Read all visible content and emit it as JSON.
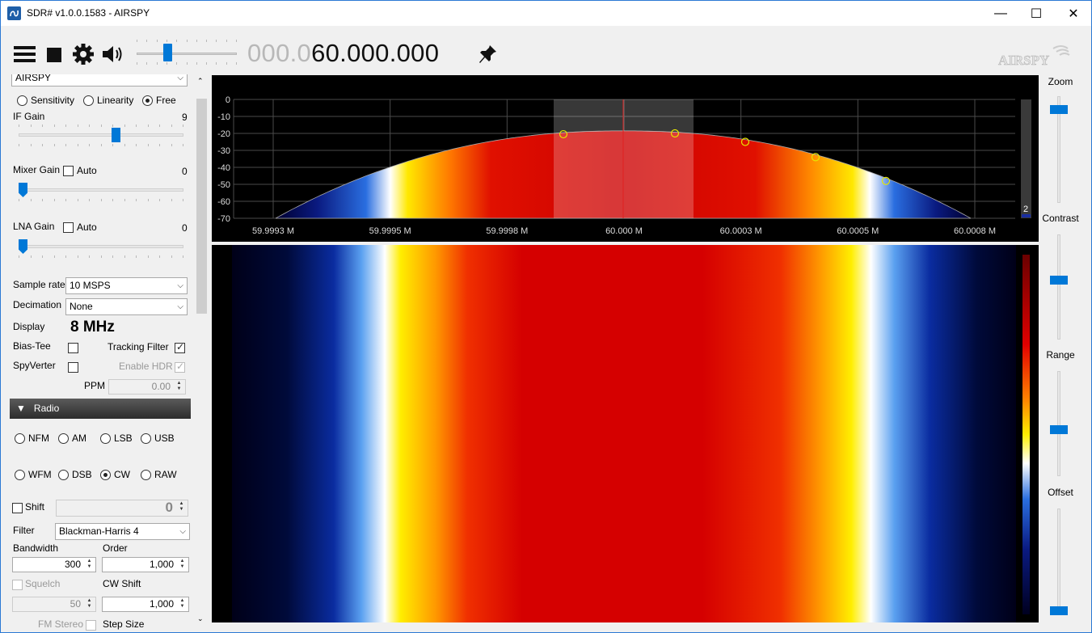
{
  "window": {
    "title": "SDR# v1.0.0.1583 - AIRSPY",
    "minimize": "—",
    "maximize": "☐",
    "close": "✕"
  },
  "toolbar": {
    "freq_dim": "000.0",
    "freq_bright": "60.000.000",
    "volume_percent": 30,
    "logo_text": "AIRSPY"
  },
  "source": {
    "device_combo": "AIRSPY",
    "gain_modes": [
      "Sensitivity",
      "Linearity",
      "Free"
    ],
    "gain_mode_selected": "Free",
    "if_gain_label": "IF Gain",
    "if_gain_value": "9",
    "mixer_gain_label": "Mixer Gain",
    "mixer_auto_label": "Auto",
    "mixer_gain_value": "0",
    "lna_gain_label": "LNA Gain",
    "lna_auto_label": "Auto",
    "lna_gain_value": "0",
    "sample_rate_label": "Sample rate",
    "sample_rate_value": "10 MSPS",
    "decimation_label": "Decimation",
    "decimation_value": "None",
    "display_label": "Display",
    "display_value": "8 MHz",
    "bias_tee_label": "Bias-Tee",
    "tracking_filter_label": "Tracking Filter",
    "spyverter_label": "SpyVerter",
    "enable_hdr_label": "Enable HDR",
    "ppm_label": "PPM",
    "ppm_value": "0.00"
  },
  "radio": {
    "header": "Radio",
    "header_arrow": "▼",
    "modes_row1": [
      "NFM",
      "AM",
      "LSB",
      "USB"
    ],
    "modes_row2": [
      "WFM",
      "DSB",
      "CW",
      "RAW"
    ],
    "mode_selected": "CW",
    "shift_label": "Shift",
    "shift_value": "0",
    "filter_label": "Filter",
    "filter_value": "Blackman-Harris 4",
    "bandwidth_label": "Bandwidth",
    "bandwidth_value": "300",
    "order_label": "Order",
    "order_value": "1,000",
    "squelch_label": "Squelch",
    "squelch_value": "50",
    "cw_shift_label": "CW Shift",
    "cw_shift_value": "1,000",
    "fm_stereo_label": "FM Stereo",
    "step_size_label": "Step Size"
  },
  "right_panel": {
    "zoom_label": "Zoom",
    "contrast_label": "Contrast",
    "range_label": "Range",
    "offset_label": "Offset"
  },
  "spectrum": {
    "y_ticks": [
      "0",
      "-10",
      "-20",
      "-30",
      "-40",
      "-50",
      "-60",
      "-70"
    ],
    "x_ticks": [
      "59.9993 M",
      "59.9995 M",
      "59.9998 M",
      "60.000 M",
      "60.0003 M",
      "60.0005 M",
      "60.0008 M"
    ],
    "level_value": "2"
  },
  "colors": {
    "accent": "#0078d7",
    "filter_line": "#e02020",
    "marker": "#e6e600"
  }
}
